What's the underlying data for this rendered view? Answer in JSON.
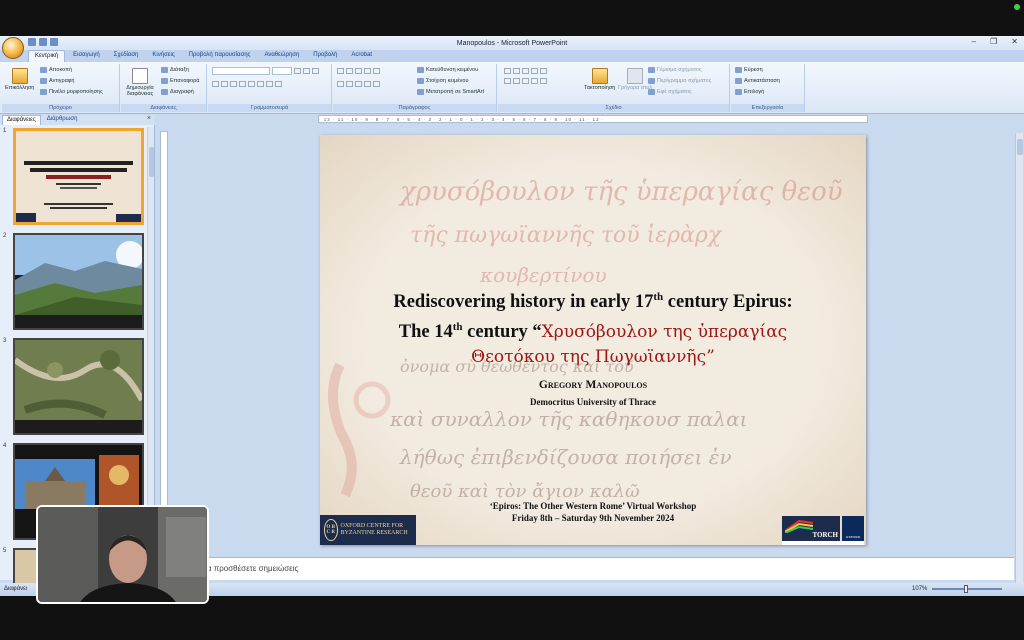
{
  "window": {
    "title": "Manopoulos - Microsoft PowerPoint"
  },
  "ribbon": {
    "tabs": [
      "Κεντρική",
      "Εισαγωγή",
      "Σχεδίαση",
      "Κινήσεις",
      "Προβολή παρουσίασης",
      "Αναθεώρηση",
      "Προβολή",
      "Acrobat"
    ],
    "active_tab": "Κεντρική",
    "clipboard": {
      "group": "Πρόχειρο",
      "paste": "Επικόλληση",
      "cut": "Αποκοπή",
      "copy": "Αντιγραφή",
      "format_painter": "Πινέλο μορφοποίησης"
    },
    "slides": {
      "group": "Διαφάνειες",
      "new_slide": "Δημιουργία διαφάνειας",
      "layout": "Διάταξη",
      "reset": "Επαναφορά",
      "delete": "Διαγραφή"
    },
    "font": {
      "group": "Γραμματοσειρά"
    },
    "paragraph": {
      "group": "Παράγραφος",
      "text_direction": "Κατεύθυνση κειμένου",
      "align_text": "Στοίχιση κειμένου",
      "smartart": "Μετατροπή σε SmartArt"
    },
    "drawing": {
      "group": "Σχέδιο",
      "arrange": "Τακτοποίηση",
      "quick_styles": "Γρήγορα στυλ",
      "shape_fill": "Γέμισμα σχήματος",
      "shape_outline": "Περίγραμμα σχήματος",
      "shape_effects": "Εφέ σχήματος"
    },
    "editing": {
      "group": "Επεξεργασία",
      "find": "Εύρεση",
      "replace": "Αντικατάσταση",
      "select": "Επιλογή"
    }
  },
  "panel": {
    "tab_slides": "Διαφάνειες",
    "tab_outline": "Διάρθρωση",
    "close": "×",
    "thumbnails": [
      {
        "number": "1"
      },
      {
        "number": "2"
      },
      {
        "number": "3"
      },
      {
        "number": "4"
      },
      {
        "number": "5"
      }
    ]
  },
  "slide": {
    "title_line1_a": "Rediscovering history in early 17",
    "title_line1_sup": "th",
    "title_line1_b": " century Epirus:",
    "title_line2_a": "The 14",
    "title_line2_sup": "th",
    "title_line2_b": " century “",
    "title_line2_greek": "Χρυσόβουλον της ὑπεραγίας",
    "title_line3_greek": "Θεοτόκου της Πωγωϊαννῆς",
    "title_line3_end": "”",
    "author": "Gregory Manopoulos",
    "university": "Democritus University of Thrace",
    "workshop_line1": "‘Epiros: The Other Western Rome’ Virtual Workshop",
    "workshop_line2": "Friday 8th – Saturday 9th November 2024",
    "logo_left_seal": "O B C R",
    "logo_left_text": "OXFORD CENTRE FOR BYZANTINE RESEARCH",
    "logo_torch": "TORCH",
    "logo_oxford": "OXFORD"
  },
  "notes": {
    "placeholder": "α να προσθέσετε σημειώσεις"
  },
  "status": {
    "left": "Διαφάνει",
    "zoom": "107%"
  },
  "colors": {
    "greek_title": "#a01616",
    "selected_thumb": "#f2a430",
    "ribbon_bg": "#dbe7f6"
  }
}
